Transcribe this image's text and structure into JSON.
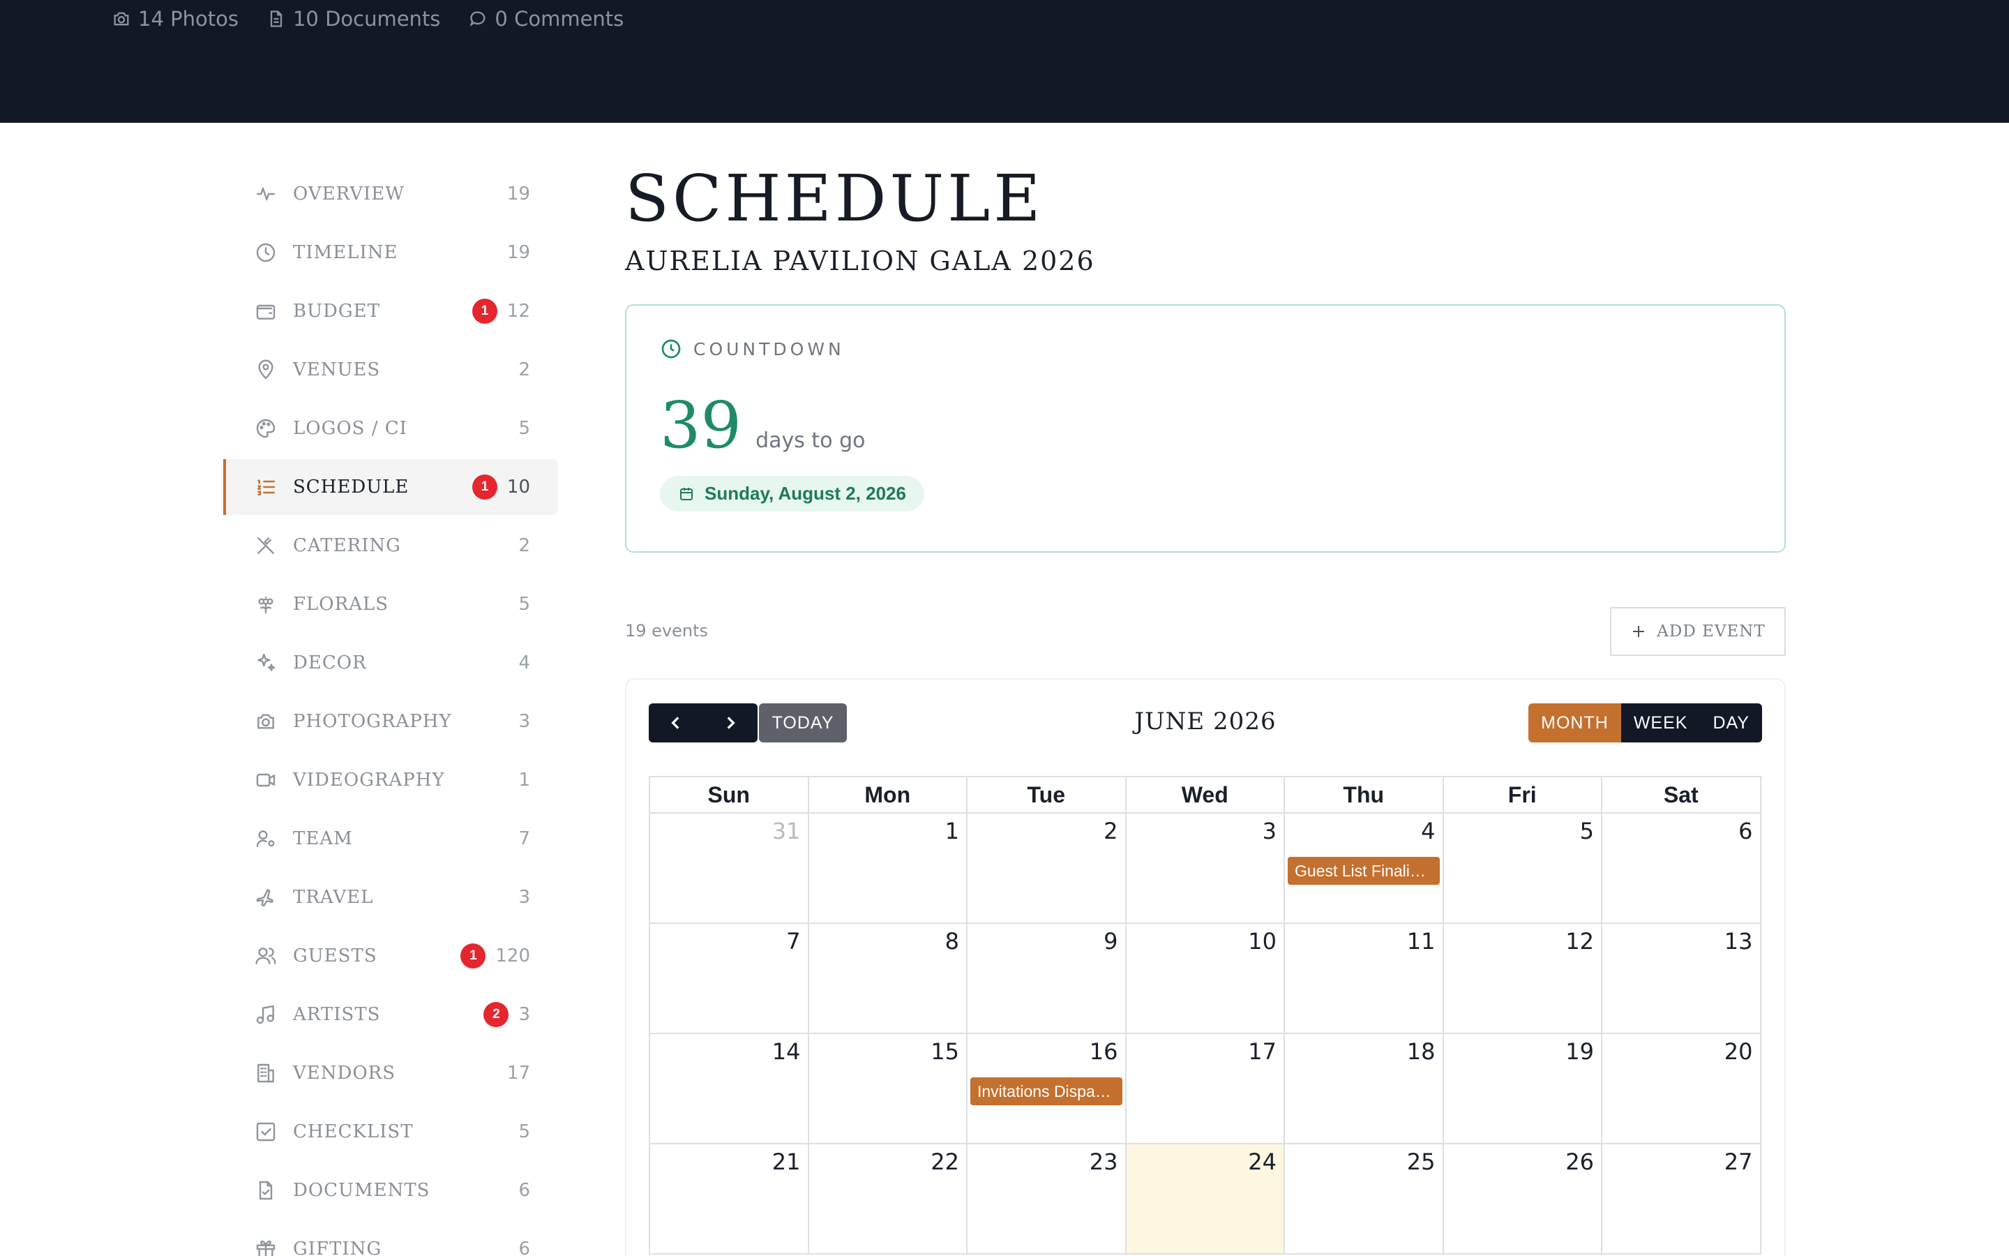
{
  "header": {
    "stats": [
      {
        "icon": "camera-icon",
        "label": "14 Photos"
      },
      {
        "icon": "document-icon",
        "label": "10 Documents"
      },
      {
        "icon": "comment-icon",
        "label": "0 Comments"
      }
    ]
  },
  "sidebar": {
    "items": [
      {
        "label": "OVERVIEW",
        "icon": "activity-icon",
        "count": "19",
        "alert": ""
      },
      {
        "label": "TIMELINE",
        "icon": "clock-icon",
        "count": "19",
        "alert": ""
      },
      {
        "label": "BUDGET",
        "icon": "wallet-icon",
        "count": "12",
        "alert": "1"
      },
      {
        "label": "VENUES",
        "icon": "map-pin-icon",
        "count": "2",
        "alert": ""
      },
      {
        "label": "LOGOS / CI",
        "icon": "palette-icon",
        "count": "5",
        "alert": ""
      },
      {
        "label": "SCHEDULE",
        "icon": "list-ordered-icon",
        "count": "10",
        "alert": "1"
      },
      {
        "label": "CATERING",
        "icon": "utensils-crossed-icon",
        "count": "2",
        "alert": ""
      },
      {
        "label": "FLORALS",
        "icon": "flower-icon",
        "count": "5",
        "alert": ""
      },
      {
        "label": "DECOR",
        "icon": "sparkles-icon",
        "count": "4",
        "alert": ""
      },
      {
        "label": "PHOTOGRAPHY",
        "icon": "camera-icon",
        "count": "3",
        "alert": ""
      },
      {
        "label": "VIDEOGRAPHY",
        "icon": "video-icon",
        "count": "1",
        "alert": ""
      },
      {
        "label": "TEAM",
        "icon": "user-cog-icon",
        "count": "7",
        "alert": ""
      },
      {
        "label": "TRAVEL",
        "icon": "plane-icon",
        "count": "3",
        "alert": ""
      },
      {
        "label": "GUESTS",
        "icon": "users-icon",
        "count": "120",
        "alert": "1"
      },
      {
        "label": "ARTISTS",
        "icon": "music-icon",
        "count": "3",
        "alert": "2"
      },
      {
        "label": "VENDORS",
        "icon": "building-icon",
        "count": "17",
        "alert": ""
      },
      {
        "label": "CHECKLIST",
        "icon": "check-square-icon",
        "count": "5",
        "alert": ""
      },
      {
        "label": "DOCUMENTS",
        "icon": "file-check-icon",
        "count": "6",
        "alert": ""
      },
      {
        "label": "GIFTING",
        "icon": "gift-icon",
        "count": "6",
        "alert": ""
      }
    ],
    "active_index": 5
  },
  "main": {
    "title": "SCHEDULE",
    "subtitle": "AURELIA PAVILION GALA 2026",
    "countdown": {
      "heading": "COUNTDOWN",
      "days": "39",
      "days_text": "days to go",
      "date": "Sunday, August 2, 2026"
    },
    "events_count": "19 events",
    "add_event_label": "ADD EVENT"
  },
  "calendar": {
    "today_label": "TODAY",
    "title": "JUNE 2026",
    "views": [
      "MONTH",
      "WEEK",
      "DAY"
    ],
    "active_view": "MONTH",
    "weekdays": [
      "Sun",
      "Mon",
      "Tue",
      "Wed",
      "Thu",
      "Fri",
      "Sat"
    ],
    "weeks": [
      [
        {
          "day": "31",
          "other": true
        },
        {
          "day": "1"
        },
        {
          "day": "2"
        },
        {
          "day": "3"
        },
        {
          "day": "4",
          "event": "Guest List Finalization"
        },
        {
          "day": "5"
        },
        {
          "day": "6"
        }
      ],
      [
        {
          "day": "7"
        },
        {
          "day": "8"
        },
        {
          "day": "9"
        },
        {
          "day": "10"
        },
        {
          "day": "11"
        },
        {
          "day": "12"
        },
        {
          "day": "13"
        }
      ],
      [
        {
          "day": "14"
        },
        {
          "day": "15"
        },
        {
          "day": "16",
          "event": "Invitations Dispatched"
        },
        {
          "day": "17"
        },
        {
          "day": "18"
        },
        {
          "day": "19"
        },
        {
          "day": "20"
        }
      ],
      [
        {
          "day": "21"
        },
        {
          "day": "22"
        },
        {
          "day": "23"
        },
        {
          "day": "24",
          "today": true
        },
        {
          "day": "25"
        },
        {
          "day": "26"
        },
        {
          "day": "27"
        }
      ]
    ]
  },
  "colors": {
    "accent": "#c4702e",
    "dark": "#121826",
    "countdown_green": "#1f8a67",
    "alert_red": "#e5262e",
    "today_highlight": "#fdf7df"
  }
}
